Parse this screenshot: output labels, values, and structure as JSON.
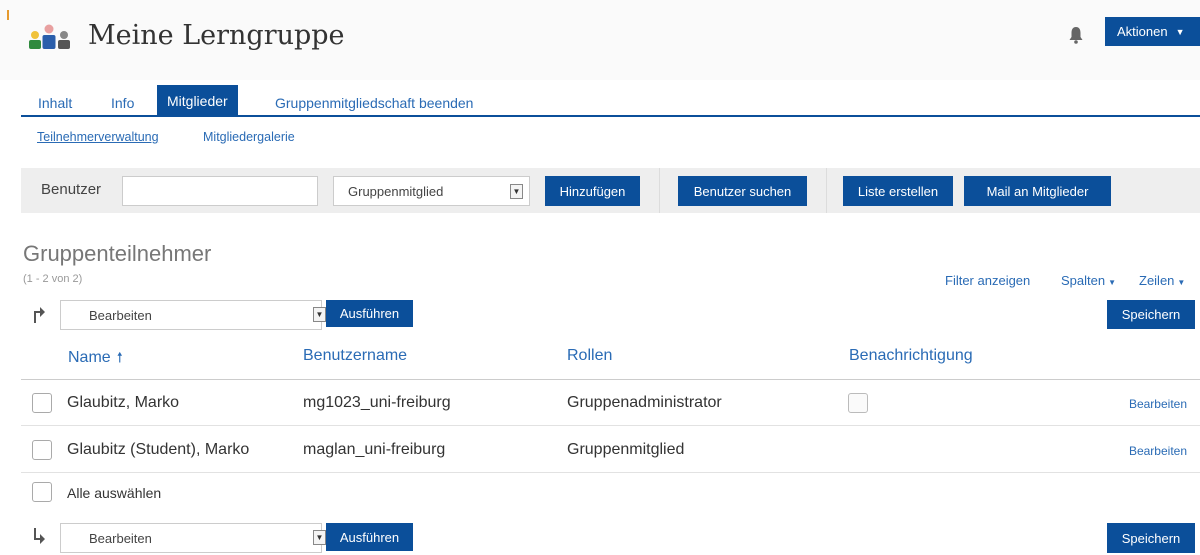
{
  "header": {
    "title": "Meine Lerngruppe",
    "group_icon": "group-people-icon",
    "bell_icon": "bell-icon",
    "actions_label": "Aktionen",
    "colors": {
      "accent": "#0b4f9a",
      "link": "#2a6bb5"
    }
  },
  "tabs": [
    {
      "label": "Inhalt",
      "active": false
    },
    {
      "label": "Info",
      "active": false
    },
    {
      "label": "Mitglieder",
      "active": true
    },
    {
      "label": "Gruppenmitgliedschaft beenden",
      "active": false
    }
  ],
  "subtabs": [
    {
      "label": "Teilnehmerverwaltung",
      "active": true
    },
    {
      "label": "Mitgliedergalerie",
      "active": false
    }
  ],
  "toolbar": {
    "user_label": "Benutzer",
    "user_input_value": "",
    "role_select": "Gruppenmitglied",
    "add_button": "Hinzufügen",
    "search_users_button": "Benutzer suchen",
    "create_list_button": "Liste erstellen",
    "mail_members_button": "Mail an Mitglieder"
  },
  "section": {
    "title": "Gruppenteilnehmer",
    "count": "(1 - 2 von 2)",
    "filter_link": "Filter anzeigen",
    "columns_link": "Spalten",
    "rows_link": "Zeilen"
  },
  "action_bar": {
    "select_value": "Bearbeiten",
    "execute_button": "Ausführen",
    "save_button": "Speichern"
  },
  "table": {
    "columns": [
      "Name",
      "Benutzername",
      "Rollen",
      "Benachrichtigung"
    ],
    "sort_indicator": "arrow-up-icon",
    "rows": [
      {
        "name": "Glaubitz, Marko",
        "username": "mg1023_uni-freiburg",
        "role": "Gruppenadministrator",
        "notification_checkbox": true,
        "edit": "Bearbeiten"
      },
      {
        "name": "Glaubitz (Student), Marko",
        "username": "maglan_uni-freiburg",
        "role": "Gruppenmitglied",
        "notification_checkbox": false,
        "edit": "Bearbeiten"
      }
    ],
    "select_all": "Alle auswählen"
  }
}
